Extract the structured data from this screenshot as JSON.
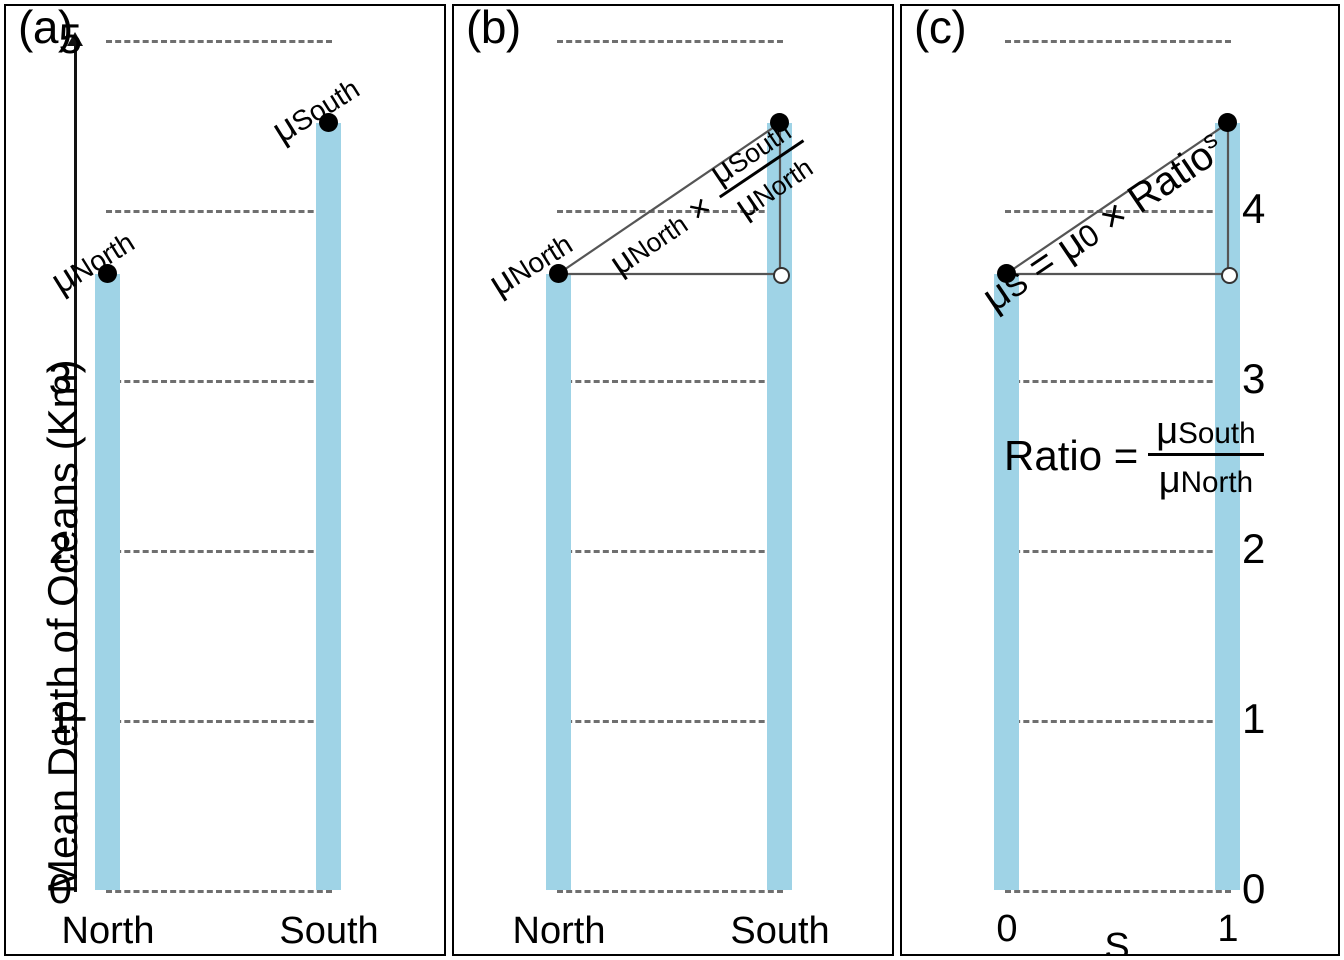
{
  "figure": {
    "axis_title_y": "Mean Depth of Oceans (Km)",
    "bar_color": "#9fd3e6",
    "grid_color": "#6f6f6f",
    "marker_color": "#000000"
  },
  "chart_data": {
    "type": "bar",
    "title": "",
    "ylabel": "Mean Depth of Oceans (Km)",
    "xlabel": "",
    "ylim": [
      0,
      5
    ],
    "yticks": [
      0,
      1,
      2,
      3,
      4,
      5
    ],
    "grid": true,
    "legend": "none",
    "panels": [
      {
        "id": "a",
        "label": "(a)",
        "categories": [
          "North",
          "South"
        ],
        "values": [
          3.62,
          4.51
        ],
        "point_labels": [
          "μNorth",
          "μSouth"
        ],
        "y_axis_visible": true,
        "ytick_labels": [
          "0",
          "1",
          "2",
          "3",
          "5"
        ],
        "xlabel": ""
      },
      {
        "id": "b",
        "label": "(b)",
        "categories": [
          "North",
          "South"
        ],
        "values": [
          3.62,
          4.51
        ],
        "point_labels": [
          "μNorth",
          ""
        ],
        "open_marker_value": 3.62,
        "annotation": "μNorth × (μSouth / μNorth)",
        "annotation_parts": {
          "lead": "μNorth ×",
          "numerator": "μSouth",
          "denominator": "μNorth"
        },
        "y_axis_visible": false,
        "xlabel": ""
      },
      {
        "id": "c",
        "label": "(c)",
        "categories": [
          "0",
          "1"
        ],
        "values": [
          3.62,
          4.51
        ],
        "open_marker_value": 3.62,
        "annotation": "μS = μ0 × Ratioˢ",
        "annotation_parts": {
          "base": "μS = μ0 × Ratio",
          "exponent": "s"
        },
        "ratio_formula": {
          "lhs": "Ratio =",
          "numerator": "μSouth",
          "denominator": "μNorth"
        },
        "y_axis_right_ticks": [
          "0",
          "1",
          "2",
          "3",
          "4"
        ],
        "xlabel": "S"
      }
    ]
  },
  "panel_a": {
    "label": "(a)",
    "ticks": {
      "t5": "5",
      "t3": "3",
      "t2": "2",
      "t1": "1",
      "t0": "0"
    },
    "bars": [
      {
        "category": "North",
        "label": "North",
        "mu": "μ",
        "mu_sub": "North"
      },
      {
        "category": "South",
        "label": "South",
        "mu": "μ",
        "mu_sub": "South"
      }
    ]
  },
  "panel_b": {
    "label": "(b)",
    "mu_north": {
      "mu": "μ",
      "sub": "North"
    },
    "formula": {
      "lead_mu": "μ",
      "lead_sub": "North",
      "times": "×",
      "num_mu": "μ",
      "num_sub": "South",
      "den_mu": "μ",
      "den_sub": "North"
    },
    "categories": [
      {
        "label": "North"
      },
      {
        "label": "South"
      }
    ]
  },
  "panel_c": {
    "label": "(c)",
    "formula": {
      "mu": "μ",
      "sub_s": "S",
      "equals": "=",
      "mu0": "μ",
      "sub_0": "0",
      "times": "×",
      "ratio": "Ratio",
      "exponent": "s"
    },
    "ratio_block": {
      "lhs": "Ratio =",
      "num_mu": "μ",
      "num_sub": "South",
      "den_mu": "μ",
      "den_sub": "North"
    },
    "right_ticks": {
      "t4": "4",
      "t3": "3",
      "t2": "2",
      "t1": "1",
      "t0": "0"
    },
    "x_ticks": {
      "x0": "0",
      "x1": "1"
    },
    "x_title": "S"
  }
}
